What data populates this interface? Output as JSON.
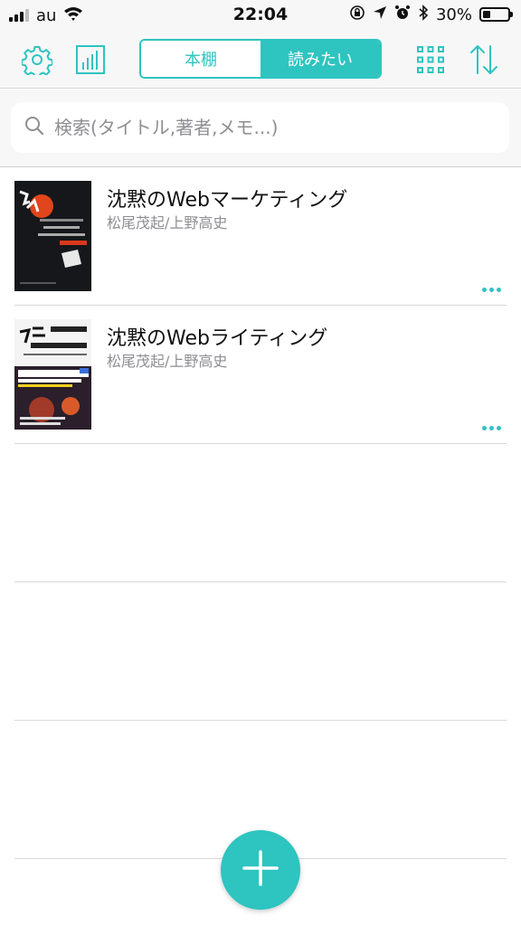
{
  "status_bar": {
    "carrier": "au",
    "time": "22:04",
    "battery_percent": "30%",
    "battery_level": 0.3,
    "icons": [
      "signal-icon",
      "wifi-icon",
      "orientation-lock-icon",
      "location-icon",
      "alarm-icon",
      "bluetooth-icon",
      "battery-icon"
    ]
  },
  "toolbar": {
    "settings_icon": "gear-icon",
    "stats_icon": "bar-chart-icon",
    "tabs": [
      {
        "label": "本棚",
        "selected": false
      },
      {
        "label": "読みたい",
        "selected": true
      }
    ],
    "grid_icon": "grid-icon",
    "sort_icon": "sort-arrows-icon"
  },
  "search": {
    "placeholder": "検索(タイトル,著者,メモ...)",
    "value": ""
  },
  "books": [
    {
      "title": "沈黙のWebマーケティング",
      "author": "松尾茂起/上野高史"
    },
    {
      "title": "沈黙のWebライティング",
      "author": "松尾茂起/上野高史"
    }
  ],
  "fab_icon": "plus-icon",
  "colors": {
    "accent": "#2ec4c0",
    "background": "#f7f7f7",
    "divider": "#d9d9d9",
    "secondary_text": "#8e8e93"
  }
}
